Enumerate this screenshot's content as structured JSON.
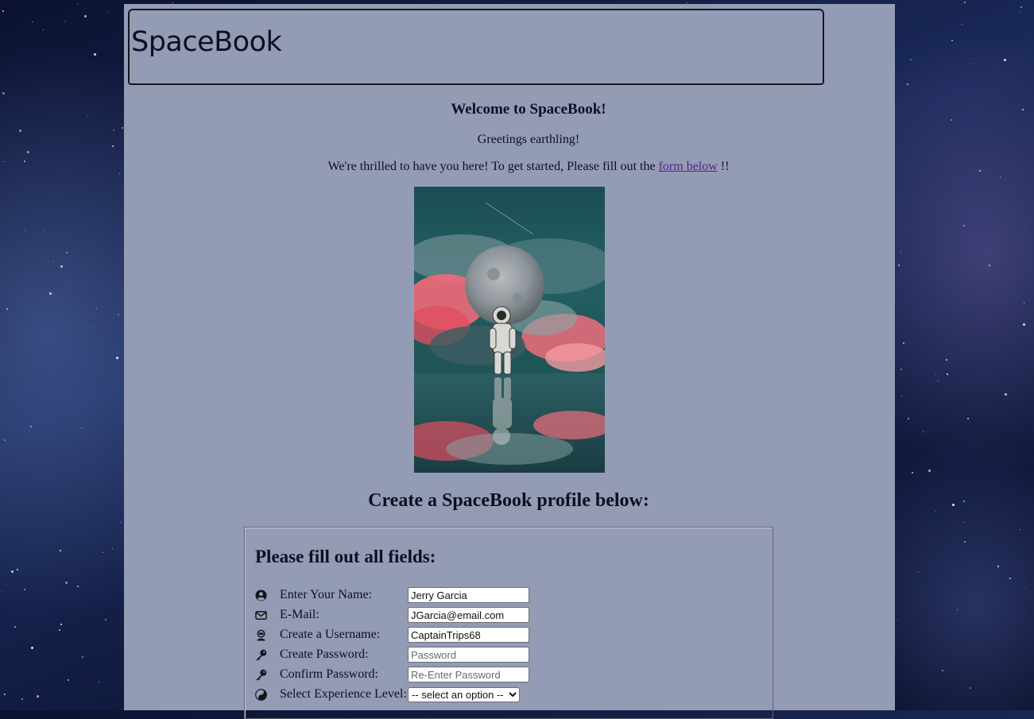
{
  "header": {
    "logo": "SpaceBook"
  },
  "intro": {
    "welcome": "Welcome to SpaceBook!",
    "greeting": "Greetings earthling!",
    "message_before": "We're thrilled to have you here! To get started, Please fill out the",
    "link_text": "form below",
    "message_after": "!!"
  },
  "form": {
    "title": "Create a SpaceBook profile below:",
    "legend": "Please fill out all fields:",
    "fields": [
      {
        "icon": "user-circle-icon",
        "label": "Enter Your Name:",
        "value": "Jerry Garcia"
      },
      {
        "icon": "envelope-icon",
        "label": "E-Mail:",
        "value": "JGarcia@email.com"
      },
      {
        "icon": "astronaut-icon",
        "label": "Create a Username:",
        "value": "CaptainTrips68"
      },
      {
        "icon": "key-icon",
        "label": "Create Password:",
        "placeholder": "Password"
      },
      {
        "icon": "key-icon",
        "label": "Confirm Password:",
        "placeholder": "Re-Enter Password"
      },
      {
        "icon": "yin-yang-icon",
        "label": "Select Experience Level:",
        "selected": "-- select an option --"
      }
    ]
  },
  "colors": {
    "page_bg": "#949bb5",
    "link": "#55218c",
    "text": "#0d1020"
  }
}
